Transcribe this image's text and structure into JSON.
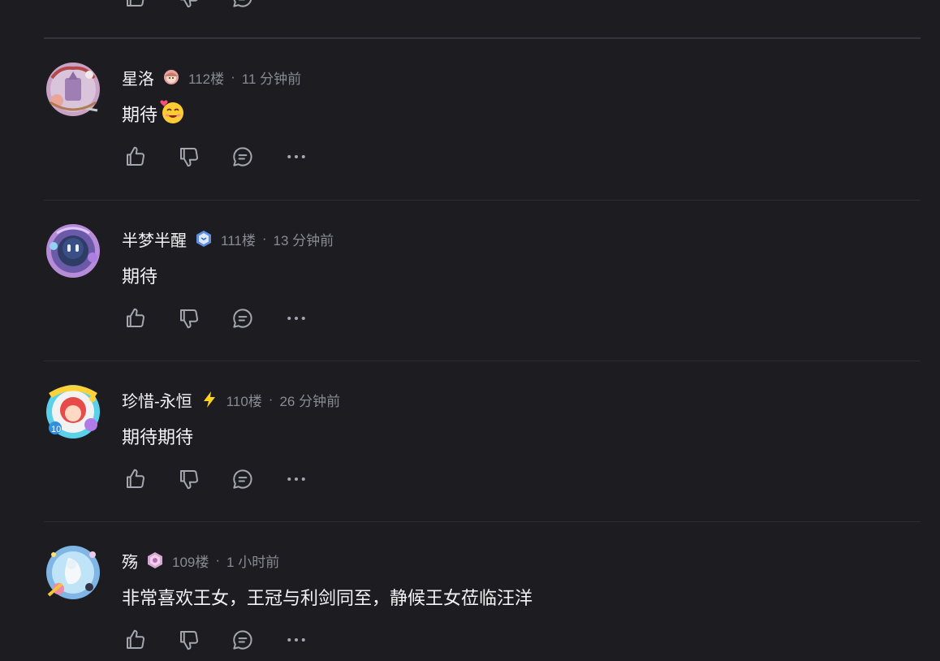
{
  "colors": {
    "background": "#1c1c21",
    "divider": "#2c2c33",
    "text_primary": "#f2f2f4",
    "text_secondary": "#8a8a94",
    "icon": "#a6a6b0"
  },
  "action_icons": [
    "thumbs-up-icon",
    "thumbs-down-icon",
    "reply-icon",
    "more-icon"
  ],
  "comments": [
    {
      "username": "星洛",
      "badge_icon": "anime-girl-badge-icon",
      "floor": "112楼",
      "separator": "·",
      "time": "11 分钟前",
      "content": "期待",
      "content_emoji": "😍-face-icon"
    },
    {
      "username": "半梦半醒",
      "badge_icon": "blue-cube-badge-icon",
      "floor": "111楼",
      "separator": "·",
      "time": "13 分钟前",
      "content": "期待"
    },
    {
      "username": "珍惜-永恒",
      "badge_icon": "lightning-badge-icon",
      "floor": "110楼",
      "separator": "·",
      "time": "26 分钟前",
      "content": "期待期待"
    },
    {
      "username": "殇",
      "badge_icon": "pink-gem-badge-icon",
      "floor": "109楼",
      "separator": "·",
      "time": "1 小时前",
      "content": "非常喜欢王女，王冠与利剑同至，静候王女莅临汪洋"
    }
  ]
}
